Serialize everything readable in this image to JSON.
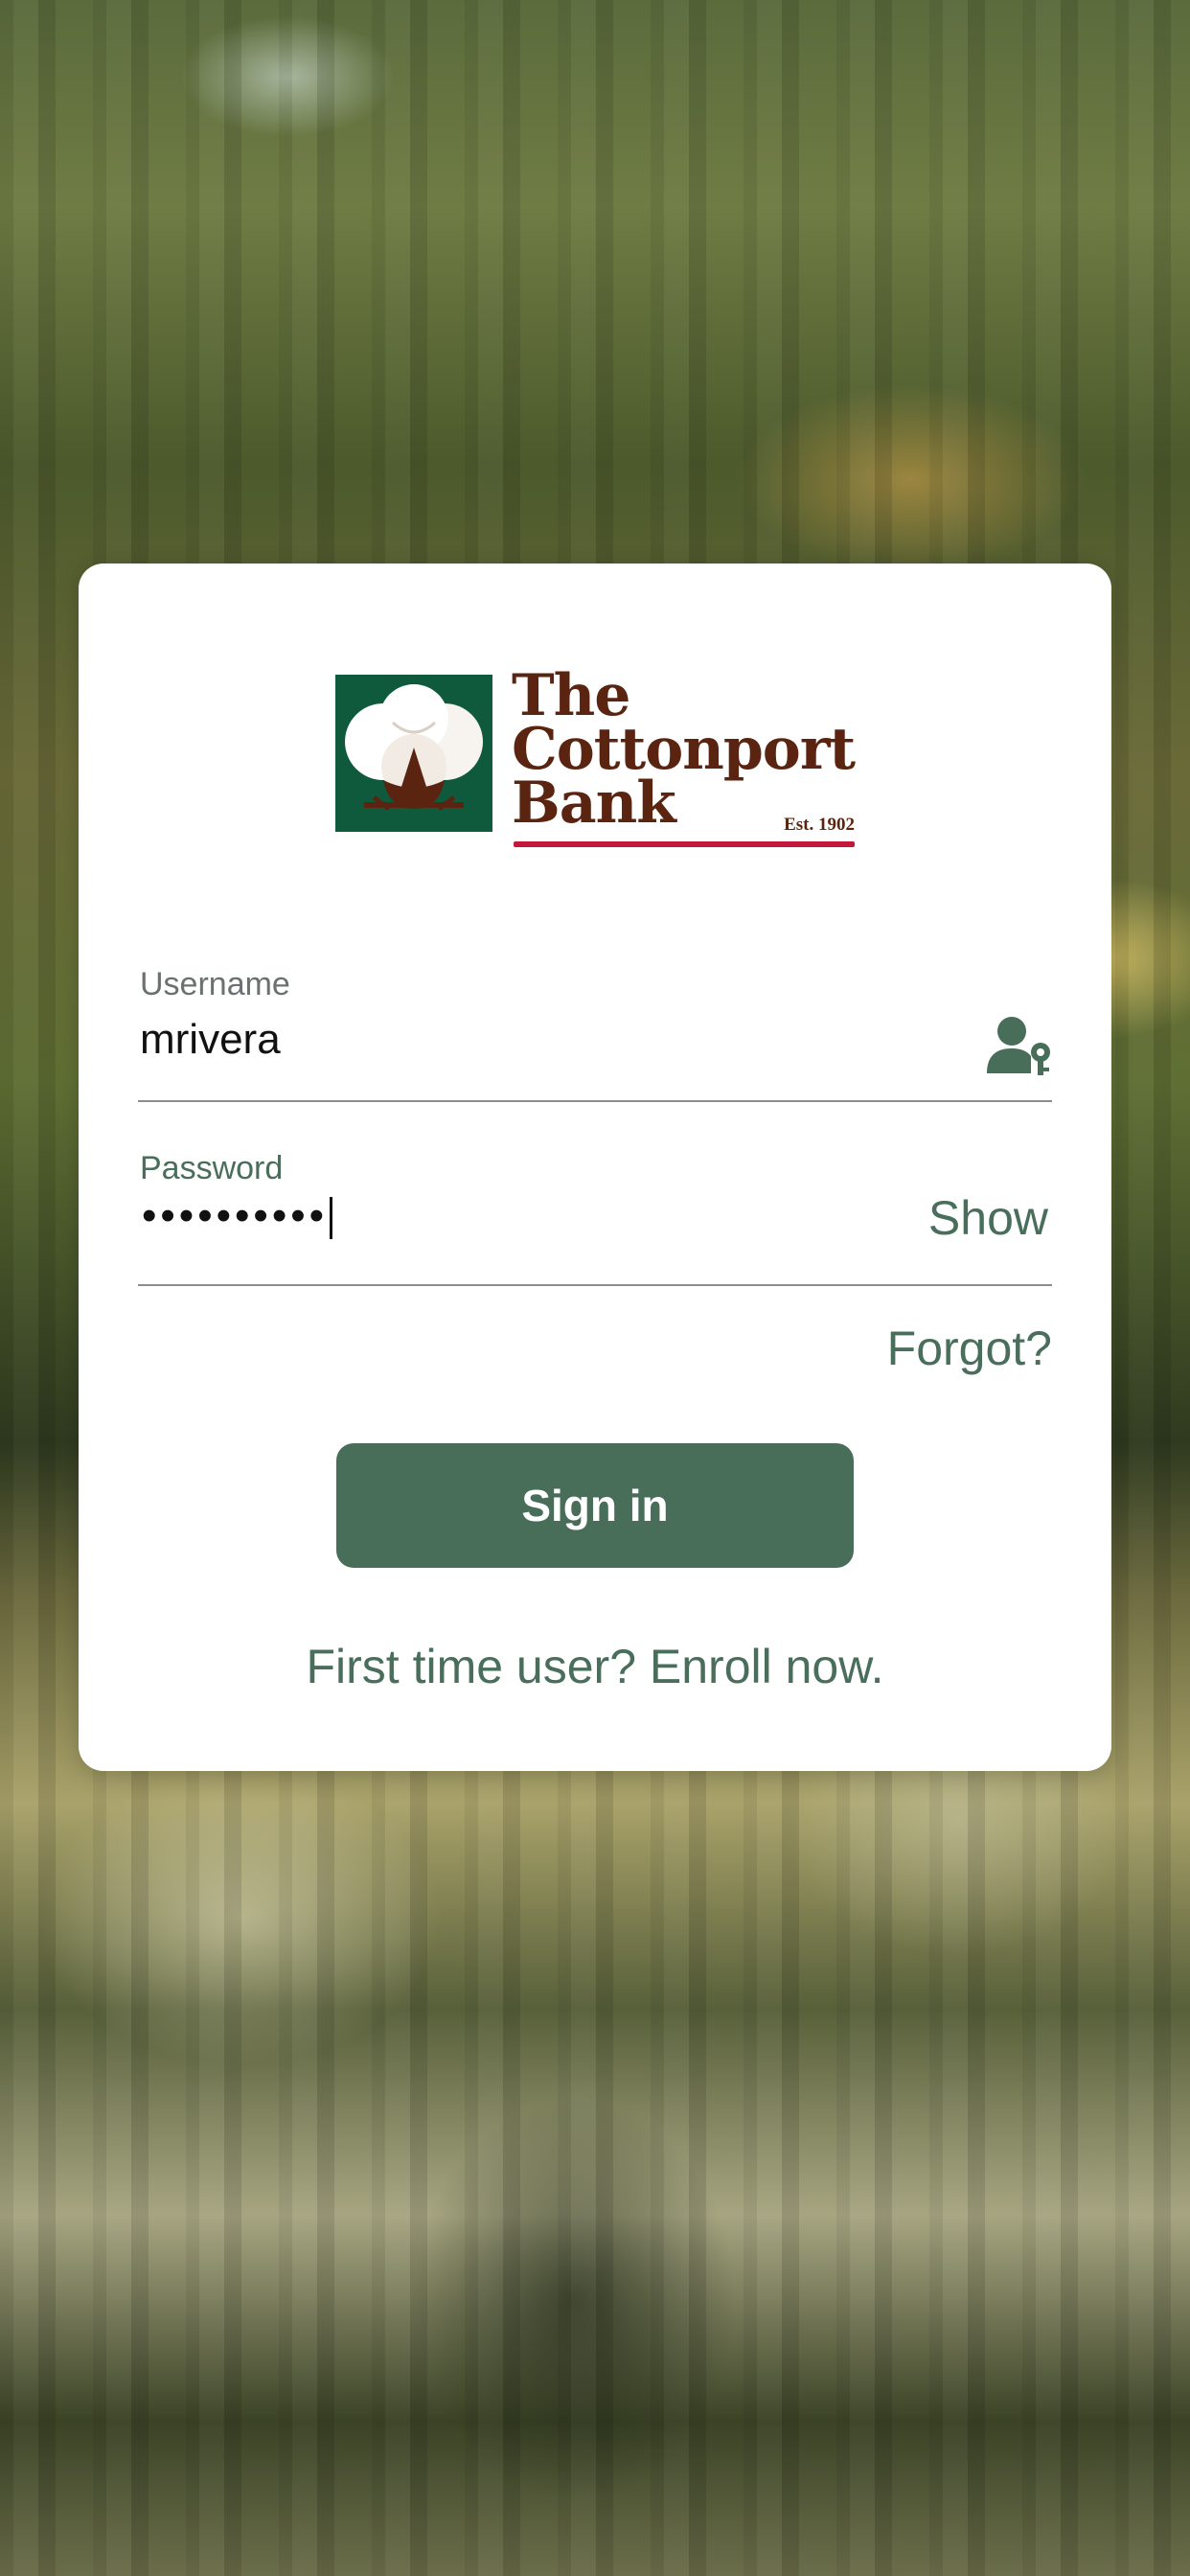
{
  "brand": {
    "name_line1": "The",
    "name_line2": "Cottonport",
    "name_line3": "Bank",
    "established": "Est. 1902",
    "colors": {
      "logo_green": "#0f5a3c",
      "logo_brown": "#5a2410",
      "logo_red": "#c4173c",
      "accent": "#486e5a"
    },
    "logo_icon": "cotton-boll-icon"
  },
  "form": {
    "username": {
      "label": "Username",
      "value": "mrivera",
      "icon": "user-key-icon"
    },
    "password": {
      "label": "Password",
      "masked_value": "••••••••••",
      "show_label": "Show"
    },
    "forgot_label": "Forgot?",
    "signin_label": "Sign in",
    "enroll_label": "First time user? Enroll now."
  }
}
